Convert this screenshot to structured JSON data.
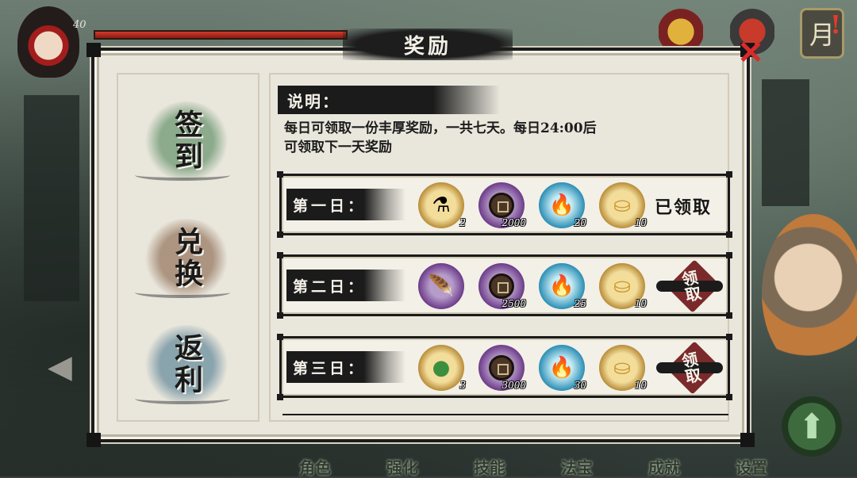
{
  "hud": {
    "level": "40"
  },
  "top_icons": {
    "moon_label": "月",
    "alert_glyph": "!"
  },
  "bottom_nav": [
    "角色",
    "强化",
    "技能",
    "法宝",
    "成就",
    "设置"
  ],
  "dialog": {
    "title": "奖励",
    "close_glyph": "✕",
    "tabs": [
      {
        "label": "签到"
      },
      {
        "label": "兑换"
      },
      {
        "label": "返利"
      }
    ],
    "description": {
      "heading": "说明：",
      "text_line1": "每日可领取一份丰厚奖励，一共七天。每日24:00后",
      "text_line2": "可领取下一天奖励"
    },
    "rows": [
      {
        "day": "第一日：",
        "items": [
          {
            "icon": "potion-icon",
            "qty": "2"
          },
          {
            "icon": "copper-coin-icon",
            "qty": "2000"
          },
          {
            "icon": "blue-flame-icon",
            "qty": "20"
          },
          {
            "icon": "gold-ingot-icon",
            "qty": "10"
          }
        ],
        "status": "已领取"
      },
      {
        "day": "第二日：",
        "items": [
          {
            "icon": "crow-feather-icon",
            "qty": ""
          },
          {
            "icon": "copper-coin-icon",
            "qty": "2500"
          },
          {
            "icon": "blue-flame-icon",
            "qty": "25"
          },
          {
            "icon": "gold-ingot-icon",
            "qty": "10"
          }
        ],
        "action": "领取"
      },
      {
        "day": "第三日：",
        "items": [
          {
            "icon": "green-pill-icon",
            "qty": "3"
          },
          {
            "icon": "copper-coin-icon",
            "qty": "3000"
          },
          {
            "icon": "blue-flame-icon",
            "qty": "30"
          },
          {
            "icon": "gold-ingot-icon",
            "qty": "10"
          }
        ],
        "action": "领取"
      }
    ]
  },
  "colors": {
    "ink": "#1b1b1b",
    "paper": "#e9e6dc",
    "hp_red": "#d23b2c",
    "stamp_red": "#7a2a2a",
    "close_red": "#d92b2b"
  }
}
